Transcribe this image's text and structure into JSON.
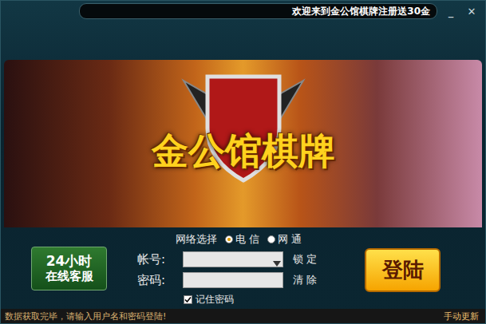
{
  "window": {
    "title": "欢迎来到金公馆棋牌注册送30金",
    "controls": [
      "_",
      "✕"
    ]
  },
  "banner": {
    "logo": "金公馆棋牌"
  },
  "network": {
    "label": "网络选择",
    "options": [
      {
        "label": "电 信",
        "selected": true
      },
      {
        "label": "网 通",
        "selected": false
      }
    ]
  },
  "support": {
    "lines": [
      "24小时",
      "在线客服"
    ]
  },
  "fields": [
    {
      "label": "帐号:",
      "value": "",
      "action": "锁 定",
      "kind": "dropdown"
    },
    {
      "label": "密码:",
      "value": "",
      "action": "清 除",
      "kind": "password"
    }
  ],
  "remember": {
    "label": "记住密码",
    "checked": true
  },
  "login_button": "登陆",
  "status_bar": {
    "message": "数据获取完毕，请输入用户名和密码登陆!",
    "update": "手动更新"
  }
}
